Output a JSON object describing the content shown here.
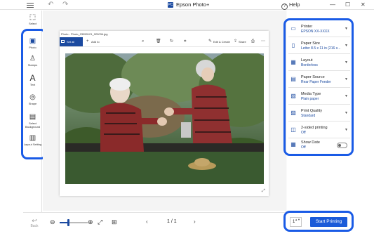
{
  "titlebar": {
    "app_title": "Epson Photo+",
    "app_logo": "PC",
    "help_label": "Help",
    "help_icon_glyph": "?",
    "undo_glyph": "↶",
    "redo_glyph": "↷",
    "minimize_glyph": "—",
    "maximize_glyph": "☐",
    "close_glyph": "✕"
  },
  "left_tools": [
    {
      "label": "Select",
      "icon": "select-icon",
      "glyph": "⬚"
    },
    {
      "label": "Photo",
      "icon": "photo-icon",
      "glyph": "▣"
    },
    {
      "label": "Stamps",
      "icon": "stamp-icon",
      "glyph": "♙"
    },
    {
      "label": "Text",
      "icon": "text-icon",
      "glyph": "A"
    },
    {
      "label": "Shape",
      "icon": "shape-icon",
      "glyph": "◎"
    },
    {
      "label": "Select Background",
      "icon": "background-icon",
      "glyph": "▤"
    },
    {
      "label": "Layout Setting",
      "icon": "layout-setting-icon",
      "glyph": "▥"
    }
  ],
  "settings": [
    {
      "title": "Printer",
      "value": "EPSON XX-XXXX",
      "icon": "printer-icon",
      "glyph": "▭"
    },
    {
      "title": "Paper Size",
      "value": "Letter 8.5 x 11 in (216 x...",
      "icon": "paper-size-icon",
      "glyph": "▯"
    },
    {
      "title": "Layout",
      "value": "Borderless",
      "icon": "layout-icon",
      "glyph": "▦"
    },
    {
      "title": "Paper Source",
      "value": "Rear Paper Feeder",
      "icon": "paper-source-icon",
      "glyph": "▤"
    },
    {
      "title": "Media Type",
      "value": "Plain paper",
      "icon": "media-type-icon",
      "glyph": "▧"
    },
    {
      "title": "Print Quality",
      "value": "Standard",
      "icon": "print-quality-icon",
      "glyph": "▨"
    },
    {
      "title": "2-sided printing",
      "value": "Off",
      "icon": "two-sided-icon",
      "glyph": "◫"
    },
    {
      "title": "Show Date",
      "value": "Off",
      "icon": "calendar-icon",
      "glyph": "▦"
    }
  ],
  "paper": {
    "filename": "Photo - Photo_23950121_020034.jpg",
    "toolbar": {
      "main_button": "Set all photos",
      "add_label": "Add to",
      "edit_label": "Edit & Create",
      "share_label": "Share",
      "add_glyph": "+",
      "zoom_glyph": "⌕",
      "delete_glyph": "🗑",
      "rotate_glyph": "↻",
      "crop_glyph": "⌗",
      "edit_glyph": "✎",
      "share_glyph": "⇪",
      "print_glyph": "⎙",
      "more_glyph": "⋯"
    },
    "expand_glyph": "⤢"
  },
  "bottombar": {
    "back_label": "Back",
    "back_glyph": "↩",
    "zoom_out_glyph": "⊖",
    "zoom_in_glyph": "⊕",
    "fit_glyph": "⤢",
    "actual_size_glyph": "⛶",
    "grid_glyph": "⊞",
    "prev_glyph": "‹",
    "next_glyph": "›",
    "page_info": "1 / 1",
    "zoom_level_fraction": 0.3
  },
  "print": {
    "copies": "1",
    "copies_arrows": "▲▼",
    "button_label": "Start Printing"
  },
  "colors": {
    "accent": "#1b4aa0",
    "highlight": "#1a5be6",
    "print_button": "#1b5bd9"
  }
}
